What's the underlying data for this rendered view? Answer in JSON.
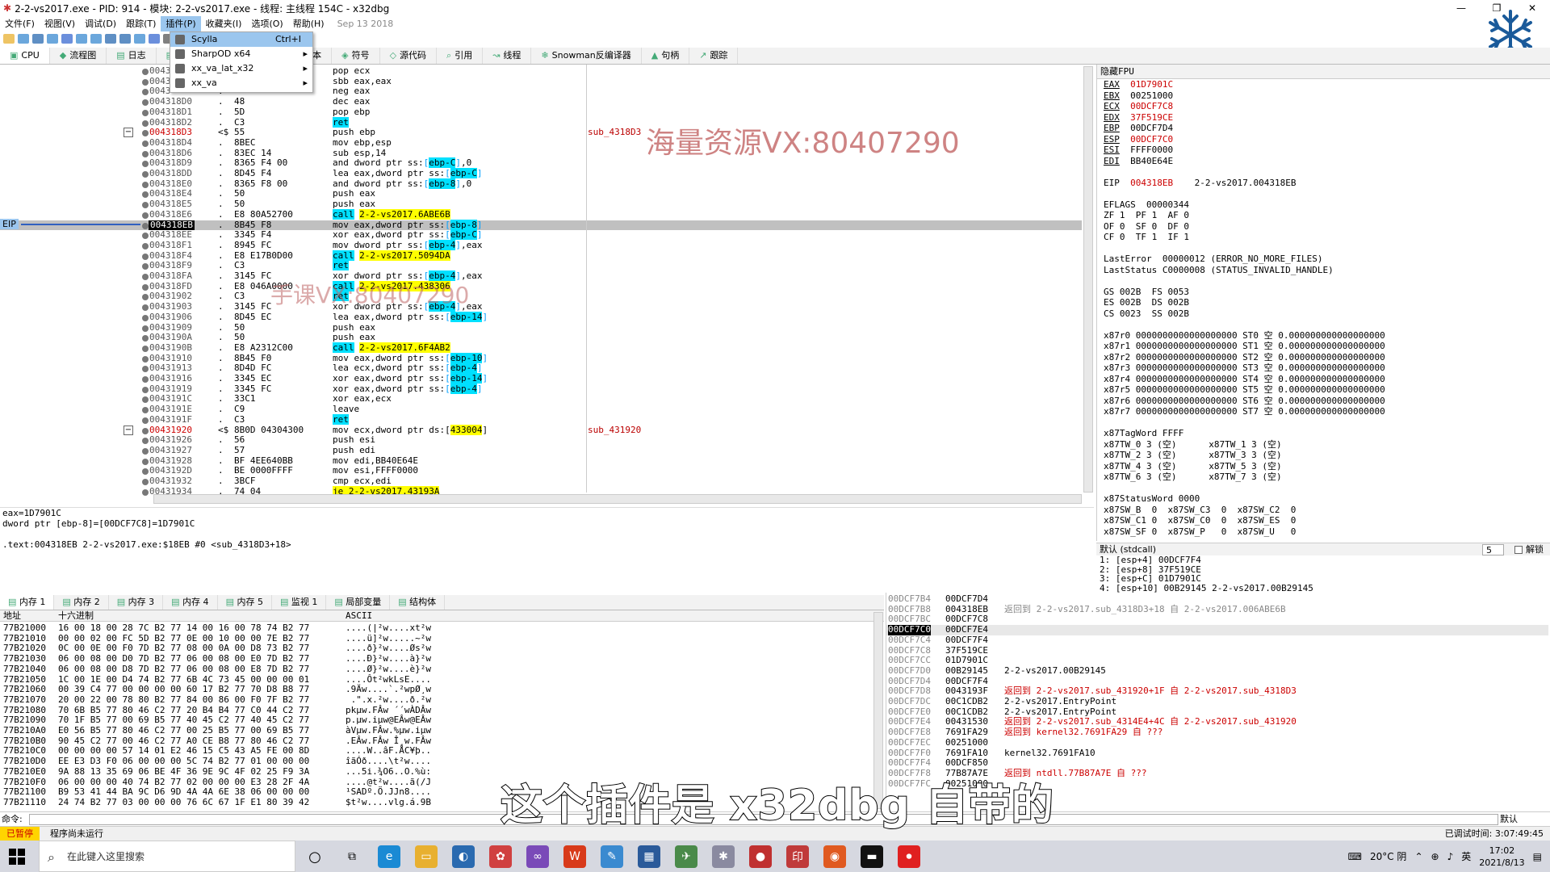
{
  "window": {
    "title": "2-2-vs2017.exe - PID: 914 - 模块: 2-2-vs2017.exe - 线程: 主线程 154C - x32dbg",
    "min": "—",
    "max": "❐",
    "close": "✕"
  },
  "menu": {
    "items": [
      "文件(F)",
      "视图(V)",
      "调试(D)",
      "跟踪(T)",
      "插件(P)",
      "收藏夹(I)",
      "选项(O)",
      "帮助(H)"
    ],
    "date": "Sep 13 2018"
  },
  "plugin_menu": {
    "items": [
      {
        "label": "Scylla",
        "shortcut": "Ctrl+I",
        "arrow": ""
      },
      {
        "label": "SharpOD x64",
        "shortcut": "",
        "arrow": "▸"
      },
      {
        "label": "xx_va_lat_x32",
        "shortcut": "",
        "arrow": "▸"
      },
      {
        "label": "xx_va",
        "shortcut": "",
        "arrow": "▸"
      }
    ]
  },
  "tabs": [
    "CPU",
    "流程图",
    "日志",
    "调用堆栈",
    "SEH链",
    "脚本",
    "符号",
    "源代码",
    "引用",
    "线程",
    "Snowman反编译器",
    "句柄",
    "跟踪"
  ],
  "eip_label": "EIP",
  "disasm": [
    {
      "addr": "0043",
      "bytes": "",
      "ins": "pop ecx",
      "cmt": ""
    },
    {
      "addr": "0043",
      "bytes": "",
      "ins": "sbb eax,eax",
      "cmt": ""
    },
    {
      "addr": "0043",
      "bytes": "",
      "ins": "neg eax",
      "cmt": ""
    },
    {
      "addr": "004318D0",
      "bytes": "48",
      "ins": "dec eax",
      "cmt": ""
    },
    {
      "addr": "004318D1",
      "bytes": "5D",
      "ins": "pop ebp",
      "cmt": ""
    },
    {
      "addr": "004318D2",
      "bytes": "C3",
      "ins": "ret",
      "cmt": ""
    },
    {
      "addr": "004318D3",
      "bytes": "55",
      "ins": "push ebp",
      "cmt": "sub_4318D3"
    },
    {
      "addr": "004318D4",
      "bytes": "8BEC",
      "ins": "mov ebp,esp",
      "cmt": ""
    },
    {
      "addr": "004318D6",
      "bytes": "83EC 14",
      "ins": "sub esp,14",
      "cmt": ""
    },
    {
      "addr": "004318D9",
      "bytes": "8365 F4 00",
      "ins": "and dword ptr ss:[ebp-C],0",
      "cmt": ""
    },
    {
      "addr": "004318DD",
      "bytes": "8D45 F4",
      "ins": "lea eax,dword ptr ss:[ebp-C]",
      "cmt": ""
    },
    {
      "addr": "004318E0",
      "bytes": "8365 F8 00",
      "ins": "and dword ptr ss:[ebp-8],0",
      "cmt": ""
    },
    {
      "addr": "004318E4",
      "bytes": "50",
      "ins": "push eax",
      "cmt": ""
    },
    {
      "addr": "004318E5",
      "bytes": "50",
      "ins": "push eax",
      "cmt": ""
    },
    {
      "addr": "004318E6",
      "bytes": "E8 80A52700",
      "ins": "call 2-2-vs2017.6ABE6B",
      "cmt": ""
    },
    {
      "addr": "004318EB",
      "bytes": "8B45 F8",
      "ins": "mov eax,dword ptr ss:[ebp-8]",
      "cmt": ""
    },
    {
      "addr": "004318EE",
      "bytes": "3345 F4",
      "ins": "xor eax,dword ptr ss:[ebp-C]",
      "cmt": ""
    },
    {
      "addr": "004318F1",
      "bytes": "8945 FC",
      "ins": "mov dword ptr ss:[ebp-4],eax",
      "cmt": ""
    },
    {
      "addr": "004318F4",
      "bytes": "E8 E17B0D00",
      "ins": "call 2-2-vs2017.5094DA",
      "cmt": ""
    },
    {
      "addr": "004318F9",
      "bytes": "C3",
      "ins": "ret",
      "cmt": ""
    },
    {
      "addr": "004318FA",
      "bytes": "3145 FC",
      "ins": "xor dword ptr ss:[ebp-4],eax",
      "cmt": ""
    },
    {
      "addr": "004318FD",
      "bytes": "E8 046A0000",
      "ins": "call 2-2-vs2017.438306",
      "cmt": ""
    },
    {
      "addr": "00431902",
      "bytes": "C3",
      "ins": "ret",
      "cmt": ""
    },
    {
      "addr": "00431903",
      "bytes": "3145 FC",
      "ins": "xor dword ptr ss:[ebp-4],eax",
      "cmt": ""
    },
    {
      "addr": "00431906",
      "bytes": "8D45 EC",
      "ins": "lea eax,dword ptr ss:[ebp-14]",
      "cmt": ""
    },
    {
      "addr": "00431909",
      "bytes": "50",
      "ins": "push eax",
      "cmt": ""
    },
    {
      "addr": "0043190A",
      "bytes": "50",
      "ins": "push eax",
      "cmt": ""
    },
    {
      "addr": "0043190B",
      "bytes": "E8 A2312C00",
      "ins": "call 2-2-vs2017.6F4AB2",
      "cmt": ""
    },
    {
      "addr": "00431910",
      "bytes": "8B45 F0",
      "ins": "mov eax,dword ptr ss:[ebp-10]",
      "cmt": ""
    },
    {
      "addr": "00431913",
      "bytes": "8D4D FC",
      "ins": "lea ecx,dword ptr ss:[ebp-4]",
      "cmt": ""
    },
    {
      "addr": "00431916",
      "bytes": "3345 EC",
      "ins": "xor eax,dword ptr ss:[ebp-14]",
      "cmt": ""
    },
    {
      "addr": "00431919",
      "bytes": "3345 FC",
      "ins": "xor eax,dword ptr ss:[ebp-4]",
      "cmt": ""
    },
    {
      "addr": "0043191C",
      "bytes": "33C1",
      "ins": "xor eax,ecx",
      "cmt": ""
    },
    {
      "addr": "0043191E",
      "bytes": "C9",
      "ins": "leave",
      "cmt": ""
    },
    {
      "addr": "0043191F",
      "bytes": "C3",
      "ins": "ret",
      "cmt": ""
    },
    {
      "addr": "00431920",
      "bytes": "8B0D 04304300",
      "ins": "mov ecx,dword ptr ds:[433004]",
      "cmt": "sub_431920"
    },
    {
      "addr": "00431926",
      "bytes": "56",
      "ins": "push esi",
      "cmt": ""
    },
    {
      "addr": "00431927",
      "bytes": "57",
      "ins": "push edi",
      "cmt": ""
    },
    {
      "addr": "00431928",
      "bytes": "BF 4EE640BB",
      "ins": "mov edi,BB40E64E",
      "cmt": ""
    },
    {
      "addr": "0043192D",
      "bytes": "BE 0000FFFF",
      "ins": "mov esi,FFFF0000",
      "cmt": ""
    },
    {
      "addr": "00431932",
      "bytes": "3BCF",
      "ins": "cmp ecx,edi",
      "cmt": ""
    },
    {
      "addr": "00431934",
      "bytes": "74 04",
      "ins": "je 2-2-vs2017.43193A",
      "cmt": ""
    }
  ],
  "info_lines": [
    "eax=1D7901C",
    "dword ptr [ebp-8]=[00DCF7C8]=1D7901C",
    "",
    ".text:004318EB 2-2-vs2017.exe:$18EB #0 <sub_4318D3+18>"
  ],
  "regs": {
    "header": "隐藏FPU",
    "gp": [
      {
        "n": "EAX",
        "v": "01D7901C",
        "red": true
      },
      {
        "n": "EBX",
        "v": "00251000",
        "red": false
      },
      {
        "n": "ECX",
        "v": "00DCF7C8",
        "red": true
      },
      {
        "n": "EDX",
        "v": "37F519CE",
        "red": true
      },
      {
        "n": "EBP",
        "v": "00DCF7D4",
        "red": false
      },
      {
        "n": "ESP",
        "v": "00DCF7C0",
        "red": true
      },
      {
        "n": "ESI",
        "v": "FFFF0000",
        "red": false
      },
      {
        "n": "EDI",
        "v": "BB40E64E",
        "red": false
      }
    ],
    "eip": {
      "n": "EIP",
      "v": "004318EB",
      "sym": "2-2-vs2017.004318EB"
    },
    "lines": [
      "EFLAGS  00000344",
      "ZF 1  PF 1  AF 0",
      "OF 0  SF 0  DF 0",
      "CF 0  TF 1  IF 1",
      "",
      "LastError  00000012 (ERROR_NO_MORE_FILES)",
      "LastStatus C0000008 (STATUS_INVALID_HANDLE)",
      "",
      "GS 002B  FS 0053",
      "ES 002B  DS 002B",
      "CS 0023  SS 002B",
      "",
      "x87r0 0000000000000000000 ST0 空 0.000000000000000000",
      "x87r1 0000000000000000000 ST1 空 0.000000000000000000",
      "x87r2 0000000000000000000 ST2 空 0.000000000000000000",
      "x87r3 0000000000000000000 ST3 空 0.000000000000000000",
      "x87r4 0000000000000000000 ST4 空 0.000000000000000000",
      "x87r5 0000000000000000000 ST5 空 0.000000000000000000",
      "x87r6 0000000000000000000 ST6 空 0.000000000000000000",
      "x87r7 0000000000000000000 ST7 空 0.000000000000000000",
      "",
      "x87TagWord FFFF",
      "x87TW_0 3 (空)      x87TW_1 3 (空)",
      "x87TW_2 3 (空)      x87TW_3 3 (空)",
      "x87TW_4 3 (空)      x87TW_5 3 (空)",
      "x87TW_6 3 (空)      x87TW_7 3 (空)",
      "",
      "x87StatusWord 0000",
      "x87SW_B  0  x87SW_C3  0  x87SW_C2  0",
      "x87SW_C1 0  x87SW_C0  0  x87SW_ES  0",
      "x87SW_SF 0  x87SW_P   0  x87SW_U   0"
    ]
  },
  "callconv": {
    "label": "默认 (stdcall)",
    "count": "5",
    "unlock": "解锁"
  },
  "callstack": [
    "1: [esp+4] 00DCF7F4",
    "2: [esp+8] 37F519CE",
    "3: [esp+C] 01D7901C",
    "4: [esp+10] 00B29145 2-2-vs2017.00B29145"
  ],
  "bottom_tabs": [
    "内存 1",
    "内存 2",
    "内存 3",
    "内存 4",
    "内存 5",
    "监视 1",
    "局部变量",
    "结构体"
  ],
  "dump": {
    "headers": [
      "地址",
      "十六进制",
      "ASCII"
    ],
    "rows": [
      [
        "77B21000",
        "16 00 18 00 28 7C B2 77 14 00 16 00 78 74 B2 77",
        "....(|²w....xt²w"
      ],
      [
        "77B21010",
        "00 00 02 00 FC 5D B2 77 0E 00 10 00 00 7E B2 77",
        "....ü]²w.....~²w"
      ],
      [
        "77B21020",
        "0C 00 0E 00 F0 7D B2 77 08 00 0A 00 D8 73 B2 77",
        "....ð}²w....Øs²w"
      ],
      [
        "77B21030",
        "06 00 08 00 D0 7D B2 77 06 00 08 00 E0 7D B2 77",
        "....Ð}²w....à}²w"
      ],
      [
        "77B21040",
        "06 00 08 00 D8 7D B2 77 06 00 08 00 E8 7D B2 77",
        "....Ø}²w....è}²w"
      ],
      [
        "77B21050",
        "1C 00 1E 00 D4 74 B2 77 6B 4C 73 45 00 00 00 01",
        "....Ôt²wkLsE...."
      ],
      [
        "77B21060",
        "00 39 C4 77 00 00 00 00 60 17 B2 77 70 D8 B8 77",
        ".9Äw....`.²wpØ¸w"
      ],
      [
        "77B21070",
        "20 00 22 00 78 80 B2 77 84 00 86 00 F0 7F B2 77",
        " .\".x.²w....ð.²w"
      ],
      [
        "77B21080",
        "70 6B B5 77 80 46 C2 77 20 B4 B4 77 C0 44 C2 77",
        "pkµw.FÂw ´´wÀDÂw"
      ],
      [
        "77B21090",
        "70 1F B5 77 00 69 B5 77 40 45 C2 77 40 45 C2 77",
        "p.µw.iµw@EÂw@EÂw"
      ],
      [
        "77B210A0",
        "E0 56 B5 77 80 46 C2 77 00 25 B5 77 00 69 B5 77",
        "àVµw.FÂw.%µw.iµw"
      ],
      [
        "77B210B0",
        "90 45 C2 77 00 46 C2 77 A0 CE B8 77 80 46 C2 77",
        ".EÂw.FÂw Î¸w.FÂw"
      ],
      [
        "77B210C0",
        "00 00 00 00 57 14 01 E2 46 15 C5 43 A5 FE 00 8D",
        "....W..âF.ÅC¥þ.."
      ],
      [
        "77B210D0",
        "EE E3 D3 F0 06 00 00 00 5C 74 B2 77 01 00 00 00",
        "îãÓð....\\t²w...."
      ],
      [
        "77B210E0",
        "9A 88 13 35 69 06 BE 4F 36 9E 9C 4F 02 25 F9 3A",
        "...5i.¾O6..O.%ù:"
      ],
      [
        "77B210F0",
        "06 00 00 00 40 74 B2 77 02 00 00 00 E3 28 2F 4A",
        "....@t²w....ã(/J"
      ],
      [
        "77B21100",
        "B9 53 41 44 BA 9C D6 9D 4A 4A 6E 38 06 00 00 00",
        "¹SADº.Ö.JJn8...."
      ],
      [
        "77B21110",
        "24 74 B2 77 03 00 00 00 76 6C 67 1F E1 80 39 42",
        "$t²w....vlg.á.9B"
      ]
    ]
  },
  "stack": [
    {
      "a": "00DCF7B4",
      "v": "00DCF7D4",
      "c": "",
      "red": false
    },
    {
      "a": "00DCF7B8",
      "v": "004318EB",
      "c": "",
      "red": false
    },
    {
      "a": "00DCF7BC",
      "v": "00DCF7C8",
      "c": "",
      "red": false
    },
    {
      "a": "00DCF7C0",
      "v": "00DCF7E4",
      "c": "",
      "red": false
    },
    {
      "a": "00DCF7C4",
      "v": "00DCF7F4",
      "c": "",
      "red": false
    },
    {
      "a": "00DCF7C8",
      "v": "37F519CE",
      "c": "",
      "red": false
    },
    {
      "a": "00DCF7CC",
      "v": "01D7901C",
      "c": "",
      "red": false
    },
    {
      "a": "00DCF7D0",
      "v": "00B29145",
      "c": "2-2-vs2017.00B29145",
      "red": false
    },
    {
      "a": "00DCF7D4",
      "v": "00DCF7F4",
      "c": "",
      "red": false
    },
    {
      "a": "00DCF7D8",
      "v": "0043193F",
      "c": "返回到 2-2-vs2017.sub_431920+1F 自 2-2-vs2017.sub_4318D3",
      "red": true
    },
    {
      "a": "00DCF7DC",
      "v": "00C1CDB2",
      "c": "2-2-vs2017.EntryPoint",
      "red": false
    },
    {
      "a": "00DCF7E0",
      "v": "00C1CDB2",
      "c": "2-2-vs2017.EntryPoint",
      "red": false
    },
    {
      "a": "00DCF7E4",
      "v": "00431530",
      "c": "返回到 2-2-vs2017.sub_4314E4+4C 自 2-2-vs2017.sub_431920",
      "red": true
    },
    {
      "a": "00DCF7E8",
      "v": "7691FA29",
      "c": "返回到 kernel32.7691FA29 自 ???",
      "red": true
    },
    {
      "a": "00DCF7EC",
      "v": "00251000",
      "c": "",
      "red": false
    },
    {
      "a": "00DCF7F0",
      "v": "7691FA10",
      "c": "kernel32.7691FA10",
      "red": false
    },
    {
      "a": "00DCF7F4",
      "v": "00DCF850",
      "c": "",
      "red": false
    },
    {
      "a": "00DCF7F8",
      "v": "77B87A7E",
      "c": "返回到 ntdll.77B87A7E 自 ???",
      "red": true
    },
    {
      "a": "00DCF7FC",
      "v": "00251000",
      "c": "",
      "red": false
    }
  ],
  "stack_top_comment": "返回到 2-2-vs2017.sub_4318D3+18 自 2-2-vs2017.006ABE6B",
  "cmd": {
    "label": "命令:",
    "default": "默认"
  },
  "status": {
    "paused": "已暂停",
    "msg": "程序尚未运行",
    "time": "已调试时间: 3:07:49:45"
  },
  "taskbar": {
    "search": "在此键入这里搜索",
    "weather": "20°C 阴",
    "ime": "英",
    "time": "17:02",
    "date": "2021/8/13"
  },
  "watermark1": "海量资源VX:80407290",
  "watermark2": "手课VX:80407290",
  "subtitle": "这个插件是 x32dbg 自带的",
  "colors": {
    "accent": "#9bc6ee",
    "cyan": "#00e0ff",
    "yellow": "#ffff00",
    "red": "#cc0000"
  }
}
